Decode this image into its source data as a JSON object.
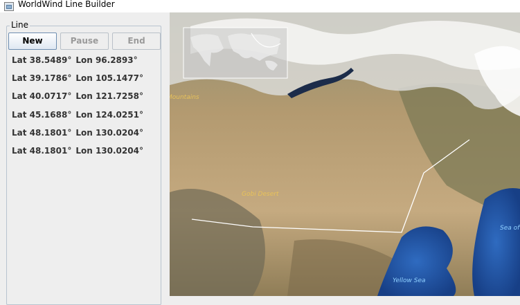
{
  "window": {
    "title": "WorldWind Line Builder",
    "icon": "app-window-icon"
  },
  "panel": {
    "group_title": "Line",
    "buttons": {
      "new": "New",
      "pause": "Pause",
      "end": "End"
    },
    "points": [
      {
        "lat": "Lat 38.5489°",
        "lon": "Lon 96.2893°"
      },
      {
        "lat": "Lat 39.1786°",
        "lon": "Lon 105.1477°"
      },
      {
        "lat": "Lat 40.0717°",
        "lon": "Lon 121.7258°"
      },
      {
        "lat": "Lat 45.1688°",
        "lon": "Lon 124.0251°"
      },
      {
        "lat": "Lat 48.1801°",
        "lon": "Lon 130.0204°"
      },
      {
        "lat": "Lat 48.1801°",
        "lon": "Lon 130.0204°"
      }
    ]
  },
  "map": {
    "labels": {
      "mountains": "Mountains",
      "gobi": "Gobi Desert",
      "yellow_sea": "Yellow Sea",
      "sea_of": "Sea of"
    },
    "colors": {
      "desert": "#c4a679",
      "snow": "#f2f2f2",
      "sea": "#2a57a6",
      "label_land": "#e8c25a",
      "label_sea": "#8fd0ff",
      "drawn_line": "#ffffff"
    }
  }
}
